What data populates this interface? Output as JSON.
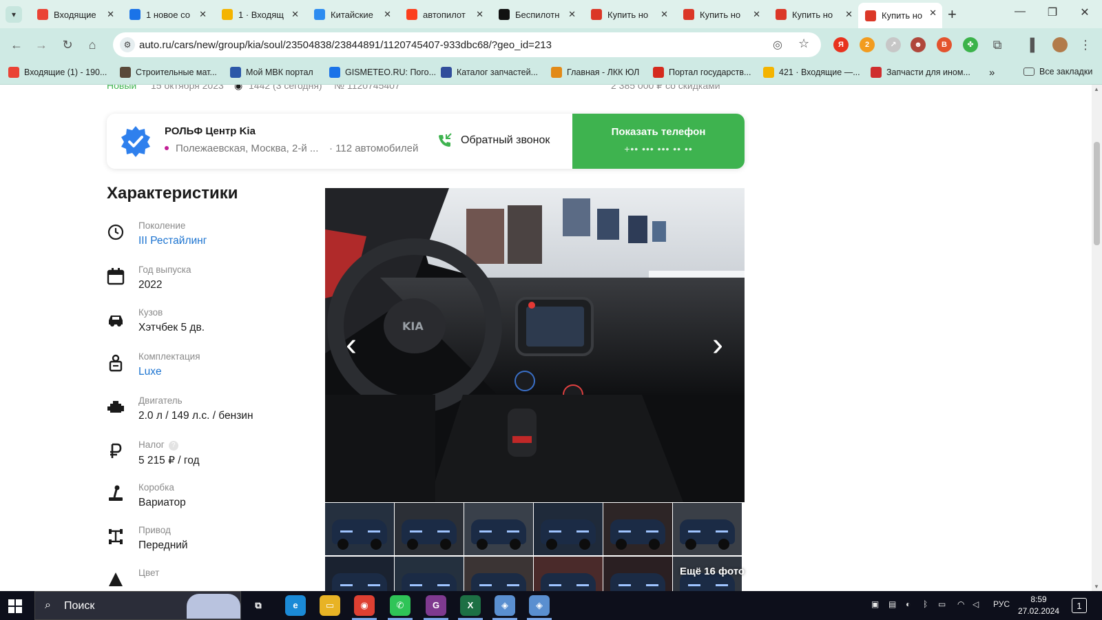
{
  "browser": {
    "tabs": [
      {
        "title": "Входящие",
        "favicon": "gmail-icon",
        "color": "#ea4335"
      },
      {
        "title": "1 новое со",
        "favicon": "badge-one-icon",
        "color": "#1a73e8"
      },
      {
        "title": "1 · Входящ",
        "favicon": "mail-envelope-icon",
        "color": "#f4b400"
      },
      {
        "title": "Китайские",
        "favicon": "drop-icon",
        "color": "#2d8cf0"
      },
      {
        "title": "автопилот",
        "favicon": "yandex-icon",
        "color": "#fc3f1d"
      },
      {
        "title": "Беспилотн",
        "favicon": "diamond-icon",
        "color": "#111111"
      },
      {
        "title": "Купить но",
        "favicon": "autoru-icon",
        "color": "#db3727"
      },
      {
        "title": "Купить но",
        "favicon": "autoru-icon",
        "color": "#db3727"
      },
      {
        "title": "Купить но",
        "favicon": "autoru-icon",
        "color": "#db3727"
      },
      {
        "title": "Купить но",
        "favicon": "autoru-icon",
        "color": "#db3727"
      }
    ],
    "active_tab_index": 9,
    "new_tab_symbol": "+",
    "window_controls": [
      "—",
      "❐",
      "✕"
    ],
    "url": "auto.ru/cars/new/group/kia/soul/23504838/23844891/1120745407-933dbc68/?geo_id=213",
    "extensions": [
      {
        "name": "yandex-ext-icon",
        "color": "#e8321e",
        "label": "Я"
      },
      {
        "name": "adblock-ext-icon",
        "color": "#f29c1f",
        "label": "2"
      },
      {
        "name": "arrow-ext-icon",
        "color": "#c7c7c7",
        "label": "↗"
      },
      {
        "name": "badge-ext-icon",
        "color": "#b0473b",
        "label": "☻"
      },
      {
        "name": "b-ext-icon",
        "color": "#e3532e",
        "label": "B"
      },
      {
        "name": "color-ext-icon",
        "color": "#3bb34a",
        "label": "✤"
      }
    ],
    "bookmarks": [
      {
        "label": "Входящие (1) - 190...",
        "color": "#ea4335"
      },
      {
        "label": "Строительные мат...",
        "color": "#5a4a3a"
      },
      {
        "label": "Мой МВК портал",
        "color": "#2b57a8"
      },
      {
        "label": "GISMETEO.RU: Пого...",
        "color": "#1a73e8"
      },
      {
        "label": "Каталог запчастей...",
        "color": "#304d9b"
      },
      {
        "label": "Главная - ЛКК ЮЛ",
        "color": "#e28a17"
      },
      {
        "label": "Портал государств...",
        "color": "#d52b1e"
      },
      {
        "label": "421 · Входящие —...",
        "color": "#f4b400"
      },
      {
        "label": "Запчасти для ином...",
        "color": "#cf2e2e"
      }
    ],
    "bookmarks_overflow": "»",
    "all_bookmarks_label": "Все закладки"
  },
  "page": {
    "topline": {
      "status": "Новый",
      "date": "15 октября 2023",
      "views": "1442 (3 сегодня)",
      "number": "№ 1120745407",
      "price": "2 385 000 ₽ со скидками"
    },
    "seller": {
      "name": "РОЛЬФ Центр Kia",
      "address": "Полежаевская, Москва, 2-й ...",
      "cars_count": "· 112 автомобилей",
      "callback_label": "Обратный звонок",
      "show_phone_label": "Показать телефон",
      "phone_mask": "+•• ••• ••• •• ••",
      "accent_green": "#3eb34f",
      "verified_blue": "#2f80ed"
    },
    "specs_title": "Характеристики",
    "specs": [
      {
        "label": "Поколение",
        "value": "III Рестайлинг",
        "link": true,
        "icon": "generation-clock-icon"
      },
      {
        "label": "Год выпуска",
        "value": "2022",
        "link": false,
        "icon": "calendar-icon"
      },
      {
        "label": "Кузов",
        "value": "Хэтчбек 5 дв.",
        "link": false,
        "icon": "car-body-icon"
      },
      {
        "label": "Комплектация",
        "value": "Luxe",
        "link": true,
        "icon": "trim-badge-icon"
      },
      {
        "label": "Двигатель",
        "value": "2.0 л / 149 л.с. / бензин",
        "link": false,
        "icon": "engine-icon"
      },
      {
        "label": "Налог",
        "value": "5 215 ₽ / год",
        "link": false,
        "icon": "ruble-icon"
      },
      {
        "label": "Коробка",
        "value": "Вариатор",
        "link": false,
        "icon": "gearbox-icon"
      },
      {
        "label": "Привод",
        "value": "Передний",
        "link": false,
        "icon": "drive-icon"
      },
      {
        "label": "Цвет",
        "value": "",
        "link": false,
        "icon": "color-triangle-icon"
      }
    ],
    "tax_help": "?",
    "gallery": {
      "prev_symbol": "‹",
      "next_symbol": "›",
      "more_photos": "Ещё 16 фото"
    }
  },
  "taskbar": {
    "search_label": "Поиск",
    "apps": [
      {
        "name": "task-view-icon",
        "label": "⧉",
        "color": "transparent"
      },
      {
        "name": "edge-icon",
        "label": "e",
        "color": "#1b8ad6"
      },
      {
        "name": "file-explorer-icon",
        "label": "▭",
        "color": "#e8b325"
      },
      {
        "name": "chrome-icon",
        "label": "◉",
        "color": "#de4032"
      },
      {
        "name": "whatsapp-icon",
        "label": "✆",
        "color": "#2fc457"
      },
      {
        "name": "pdf-app-icon",
        "label": "G",
        "color": "#7f3a8f"
      },
      {
        "name": "excel-icon",
        "label": "X",
        "color": "#1d7044"
      },
      {
        "name": "remote-app-icon",
        "label": "◈",
        "color": "#5a8fd0"
      },
      {
        "name": "remote-app-2-icon",
        "label": "◈",
        "color": "#5a8fd0"
      }
    ],
    "language": "РУС",
    "time": "8:59",
    "date": "27.02.2024",
    "notifications": "1"
  }
}
